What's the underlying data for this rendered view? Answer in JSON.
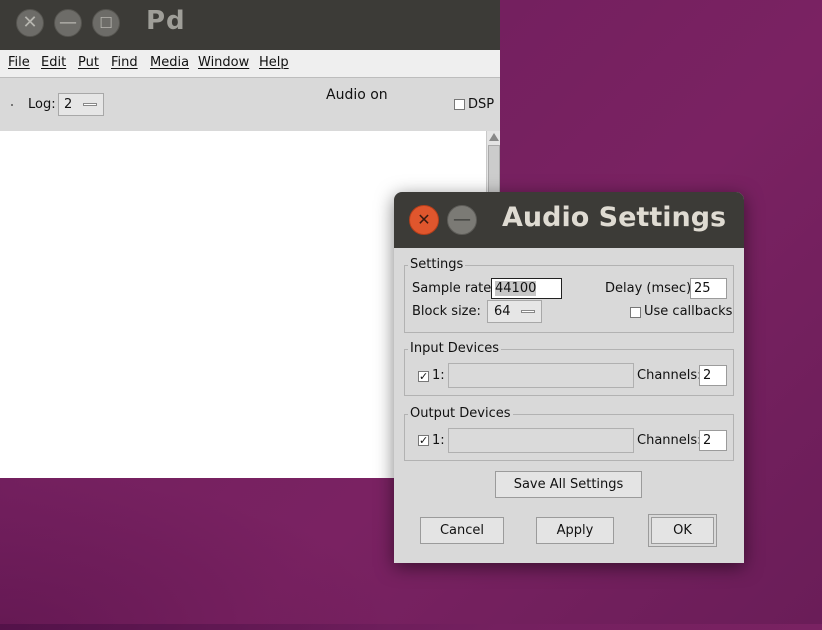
{
  "pd_window": {
    "title": "Pd",
    "menu": [
      "File",
      "Edit",
      "Put",
      "Find",
      "Media",
      "Window",
      "Help"
    ],
    "log_label": "Log:",
    "log_value": "2",
    "audio_status": "Audio on",
    "dsp_label": "DSP",
    "dsp_checked": false
  },
  "audio_settings": {
    "title": "Audio Settings",
    "settings_group": "Settings",
    "sample_rate_label": "Sample rate:",
    "sample_rate_value": "44100",
    "delay_label": "Delay (msec):",
    "delay_value": "25",
    "block_size_label": "Block size:",
    "block_size_value": "64",
    "use_callbacks_label": "Use callbacks",
    "use_callbacks_checked": false,
    "input_group": "Input Devices",
    "input_device_index": "1:",
    "input_device_checked": true,
    "input_device_name": "",
    "input_channels_label": "Channels:",
    "input_channels_value": "2",
    "output_group": "Output Devices",
    "output_device_index": "1:",
    "output_device_checked": true,
    "output_device_name": "",
    "output_channels_label": "Channels:",
    "output_channels_value": "2",
    "save_all_label": "Save All Settings",
    "cancel_label": "Cancel",
    "apply_label": "Apply",
    "ok_label": "OK"
  }
}
